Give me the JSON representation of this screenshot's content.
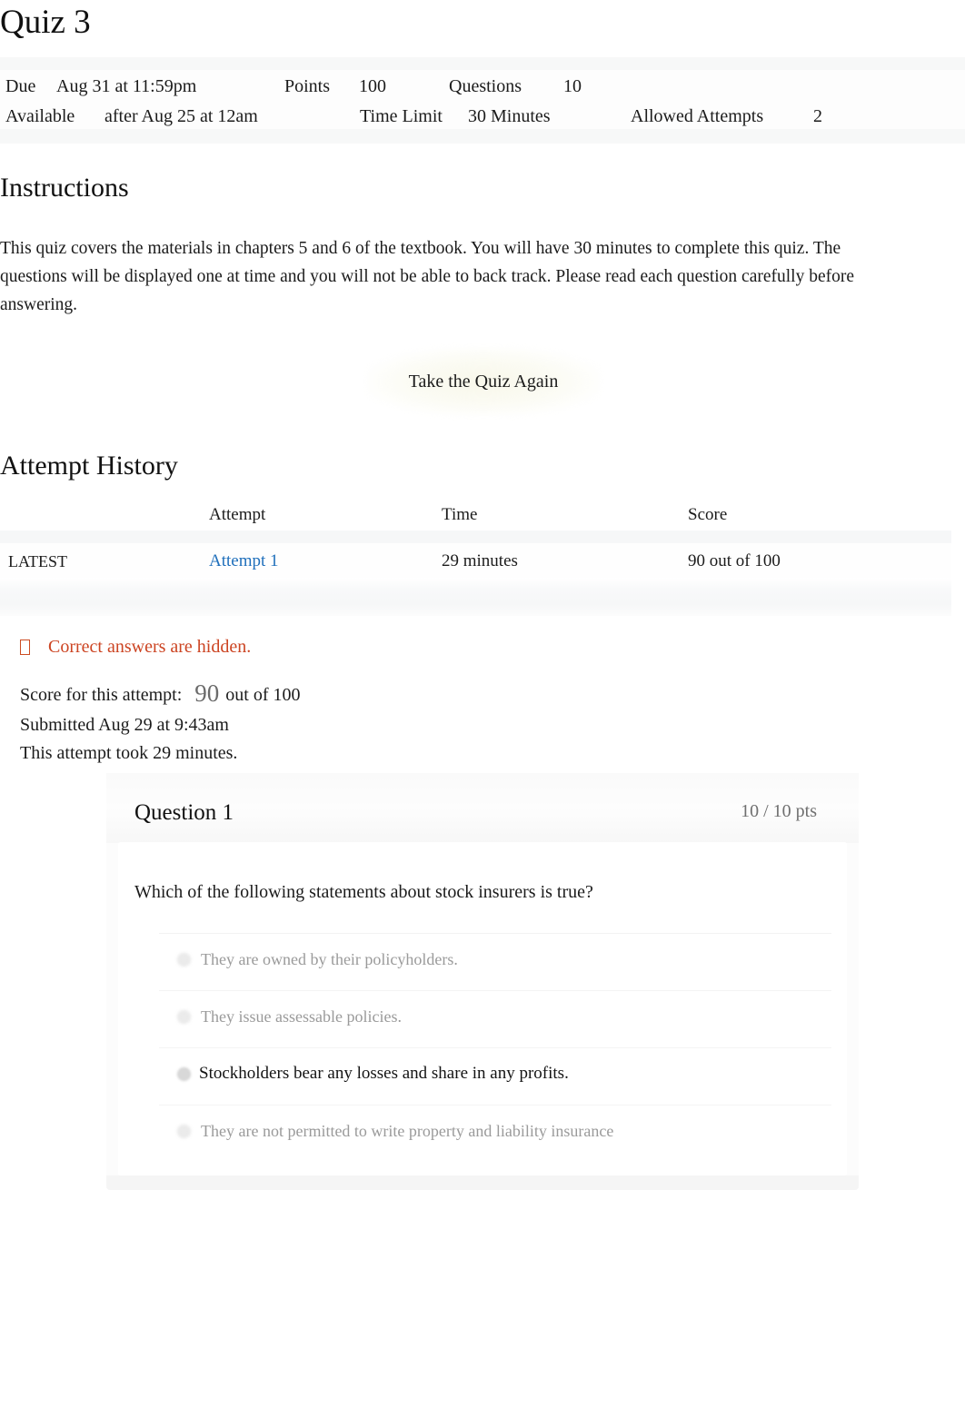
{
  "page": {
    "title": "Quiz 3"
  },
  "details": {
    "due_label": "Due",
    "due_value": "Aug 31 at 11:59pm",
    "points_label": "Points",
    "points_value": "100",
    "questions_label": "Questions",
    "questions_value": "10",
    "available_label": "Available",
    "available_value": "after Aug 25 at 12am",
    "time_limit_label": "Time Limit",
    "time_limit_value": "30 Minutes",
    "allowed_attempts_label": "Allowed Attempts",
    "allowed_attempts_value": "2"
  },
  "instructions": {
    "heading": "Instructions",
    "body": "This quiz covers the materials in chapters 5 and 6 of the textbook. You will have 30 minutes to complete this quiz. The questions will be displayed one at time and you will not be able to back track. Please read each question carefully before answering."
  },
  "actions": {
    "take_again_label": "Take the Quiz Again"
  },
  "attempt_history": {
    "heading": "Attempt History",
    "columns": [
      "",
      "Attempt",
      "Time",
      "Score"
    ],
    "rows": [
      {
        "latest_badge": "LATEST",
        "attempt": "Attempt 1",
        "time": "29 minutes",
        "score": "90 out of 100"
      }
    ]
  },
  "notice": {
    "icon": "warning-box-icon",
    "text": "Correct answers are hidden."
  },
  "score_summary": {
    "label": "Score for this attempt:",
    "score": "90",
    "out_of": "out of 100",
    "submitted": "Submitted Aug 29 at 9:43am",
    "duration": "This attempt took 29 minutes."
  },
  "question": {
    "title": "Question 1",
    "points": "10 / 10 pts",
    "prompt": "Which of the following statements about stock insurers is true?",
    "answers": [
      {
        "text": "They are owned by their policyholders.",
        "selected": false
      },
      {
        "text": "They issue assessable policies.",
        "selected": false
      },
      {
        "text": "Stockholders bear any losses and share in any profits.",
        "selected": true
      },
      {
        "text": "They are not permitted to write property and liability insurance",
        "selected": false
      }
    ]
  },
  "colors": {
    "link": "#1f6fbb",
    "notice": "#cc4422",
    "text": "#1b1b1b",
    "muted": "#9a9a9a"
  }
}
